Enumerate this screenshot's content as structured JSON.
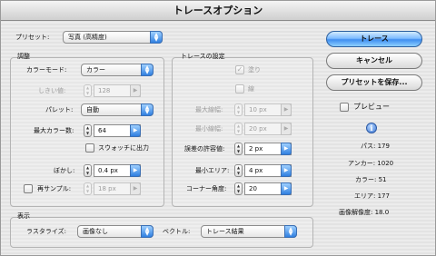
{
  "window": {
    "title": "トレースオプション"
  },
  "preset": {
    "label": "プリセット:",
    "value": "写真 (高精度)"
  },
  "adjust": {
    "title": "調整",
    "mode_label": "カラーモード:",
    "mode_value": "カラー",
    "threshold_label": "しきい値:",
    "threshold_value": "128",
    "palette_label": "パレット:",
    "palette_value": "自動",
    "maxcolors_label": "最大カラー数:",
    "maxcolors_value": "64",
    "swatch_label": "スウォッチに出力",
    "blur_label": "ぼかし:",
    "blur_value": "0.4 px",
    "resample_label": "再サンプル:",
    "resample_value": "18 px"
  },
  "trace": {
    "title": "トレースの設定",
    "fill_label": "塗り",
    "stroke_label": "線",
    "maxstroke_label": "最大線幅:",
    "maxstroke_value": "10 px",
    "minstroke_label": "最小線幅:",
    "minstroke_value": "20 px",
    "tolerance_label": "誤差の許容値:",
    "tolerance_value": "2 px",
    "minarea_label": "最小エリア:",
    "minarea_value": "4 px",
    "corner_label": "コーナー角度:",
    "corner_value": "20"
  },
  "buttons": {
    "trace": "トレース",
    "cancel": "キャンセル",
    "save_preset": "プリセットを保存..."
  },
  "preview_label": "プレビュー",
  "stats": {
    "paths": "パス: 179",
    "anchors": "アンカー: 1020",
    "colors": "カラー: 51",
    "areas": "エリア: 177",
    "resolution": "画像解像度: 18.0"
  },
  "display": {
    "title": "表示",
    "raster_label": "ラスタライズ:",
    "raster_value": "画像なし",
    "vector_label": "ベクトル:",
    "vector_value": "トレース結果"
  }
}
